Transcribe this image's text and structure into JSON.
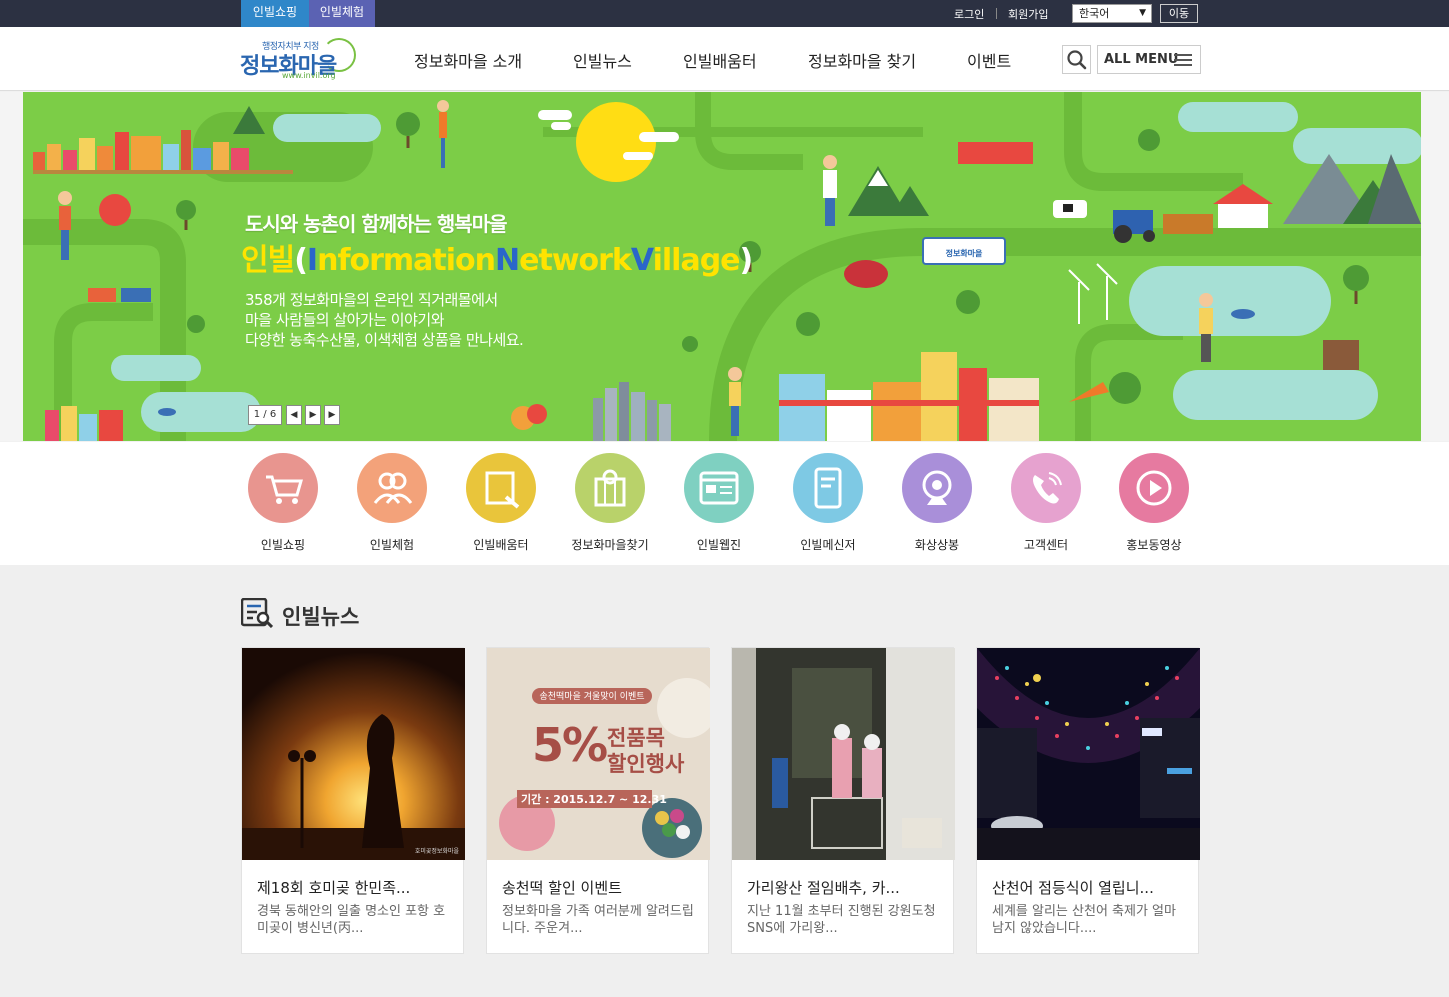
{
  "topbar": {
    "tab_shopping": "인빌쇼핑",
    "tab_experience": "인빌체험",
    "login": "로그인",
    "join": "회원가입",
    "language": "한국어",
    "go": "이동"
  },
  "header": {
    "logo_small": "행정자치부 지정",
    "logo_big": "정보화마을",
    "logo_url": "www.invil.org",
    "nav": [
      "정보화마을 소개",
      "인빌뉴스",
      "인빌배움터",
      "정보화마을 찾기",
      "이벤트"
    ],
    "all_menu": "ALL MENU"
  },
  "banner": {
    "heading": "도시와 농촌이 함께하는 행복마을",
    "title_prefix": "인빌",
    "title_open": "(",
    "title_w1_initial": "I",
    "title_w1_rest": "nformation",
    "title_w2_initial": "N",
    "title_w2_rest": "etwork",
    "title_w3_initial": "V",
    "title_w3_rest": "illage",
    "title_close": ")",
    "desc_line1": "358개 정보화마을의 온라인 직거래몰에서",
    "desc_line2": "마을 사람들의 살아가는 이야기와",
    "desc_line3": "다양한 농축수산물, 이색체험 상품을 만나세요.",
    "sign_text": "정보화마을",
    "pager": "1 / 6"
  },
  "quick": [
    {
      "label": "인빌쇼핑",
      "color": "#e8958f",
      "icon": "cart-icon"
    },
    {
      "label": "인빌체험",
      "color": "#f3a27a",
      "icon": "people-icon"
    },
    {
      "label": "인빌배움터",
      "color": "#e9c53b",
      "icon": "edu-icon"
    },
    {
      "label": "정보화마을찾기",
      "color": "#b9d26a",
      "icon": "map-icon"
    },
    {
      "label": "인빌웹진",
      "color": "#7fd0c1",
      "icon": "webzine-icon"
    },
    {
      "label": "인빌메신저",
      "color": "#7ec9e4",
      "icon": "messenger-icon"
    },
    {
      "label": "화상상봉",
      "color": "#a98fd9",
      "icon": "webcam-icon"
    },
    {
      "label": "고객센터",
      "color": "#e6a2cf",
      "icon": "phone-icon"
    },
    {
      "label": "홍보동영상",
      "color": "#e67aa0",
      "icon": "play-icon"
    }
  ],
  "news": {
    "title": "인빌뉴스",
    "cards": [
      {
        "title": "제18회 호미곶 한민족...",
        "desc": "경북 동해안의 일출 명소인 포항 호미곶이 병신년(丙...",
        "caption": "호미곶정보화마을"
      },
      {
        "title": "송천떡 할인 이벤트",
        "desc": "정보화마을 가족 여러분께 알려드립니다. 주운겨...",
        "poster_top": "송천떡마을 겨울맞이 이벤트",
        "poster_pct": "5%",
        "poster_l1": "전품목",
        "poster_l2": "할인행사",
        "poster_date": "기간 : 2015.12.7 ~ 12.31"
      },
      {
        "title": "가리왕산 절임배추, 카...",
        "desc": "지난 11월 초부터 진행된 강원도청 SNS에 가리왕..."
      },
      {
        "title": "산천어 점등식이 열립니...",
        "desc": "세계를 알리는 산천어 축제가 얼마 남지 않았습니다...."
      }
    ]
  }
}
